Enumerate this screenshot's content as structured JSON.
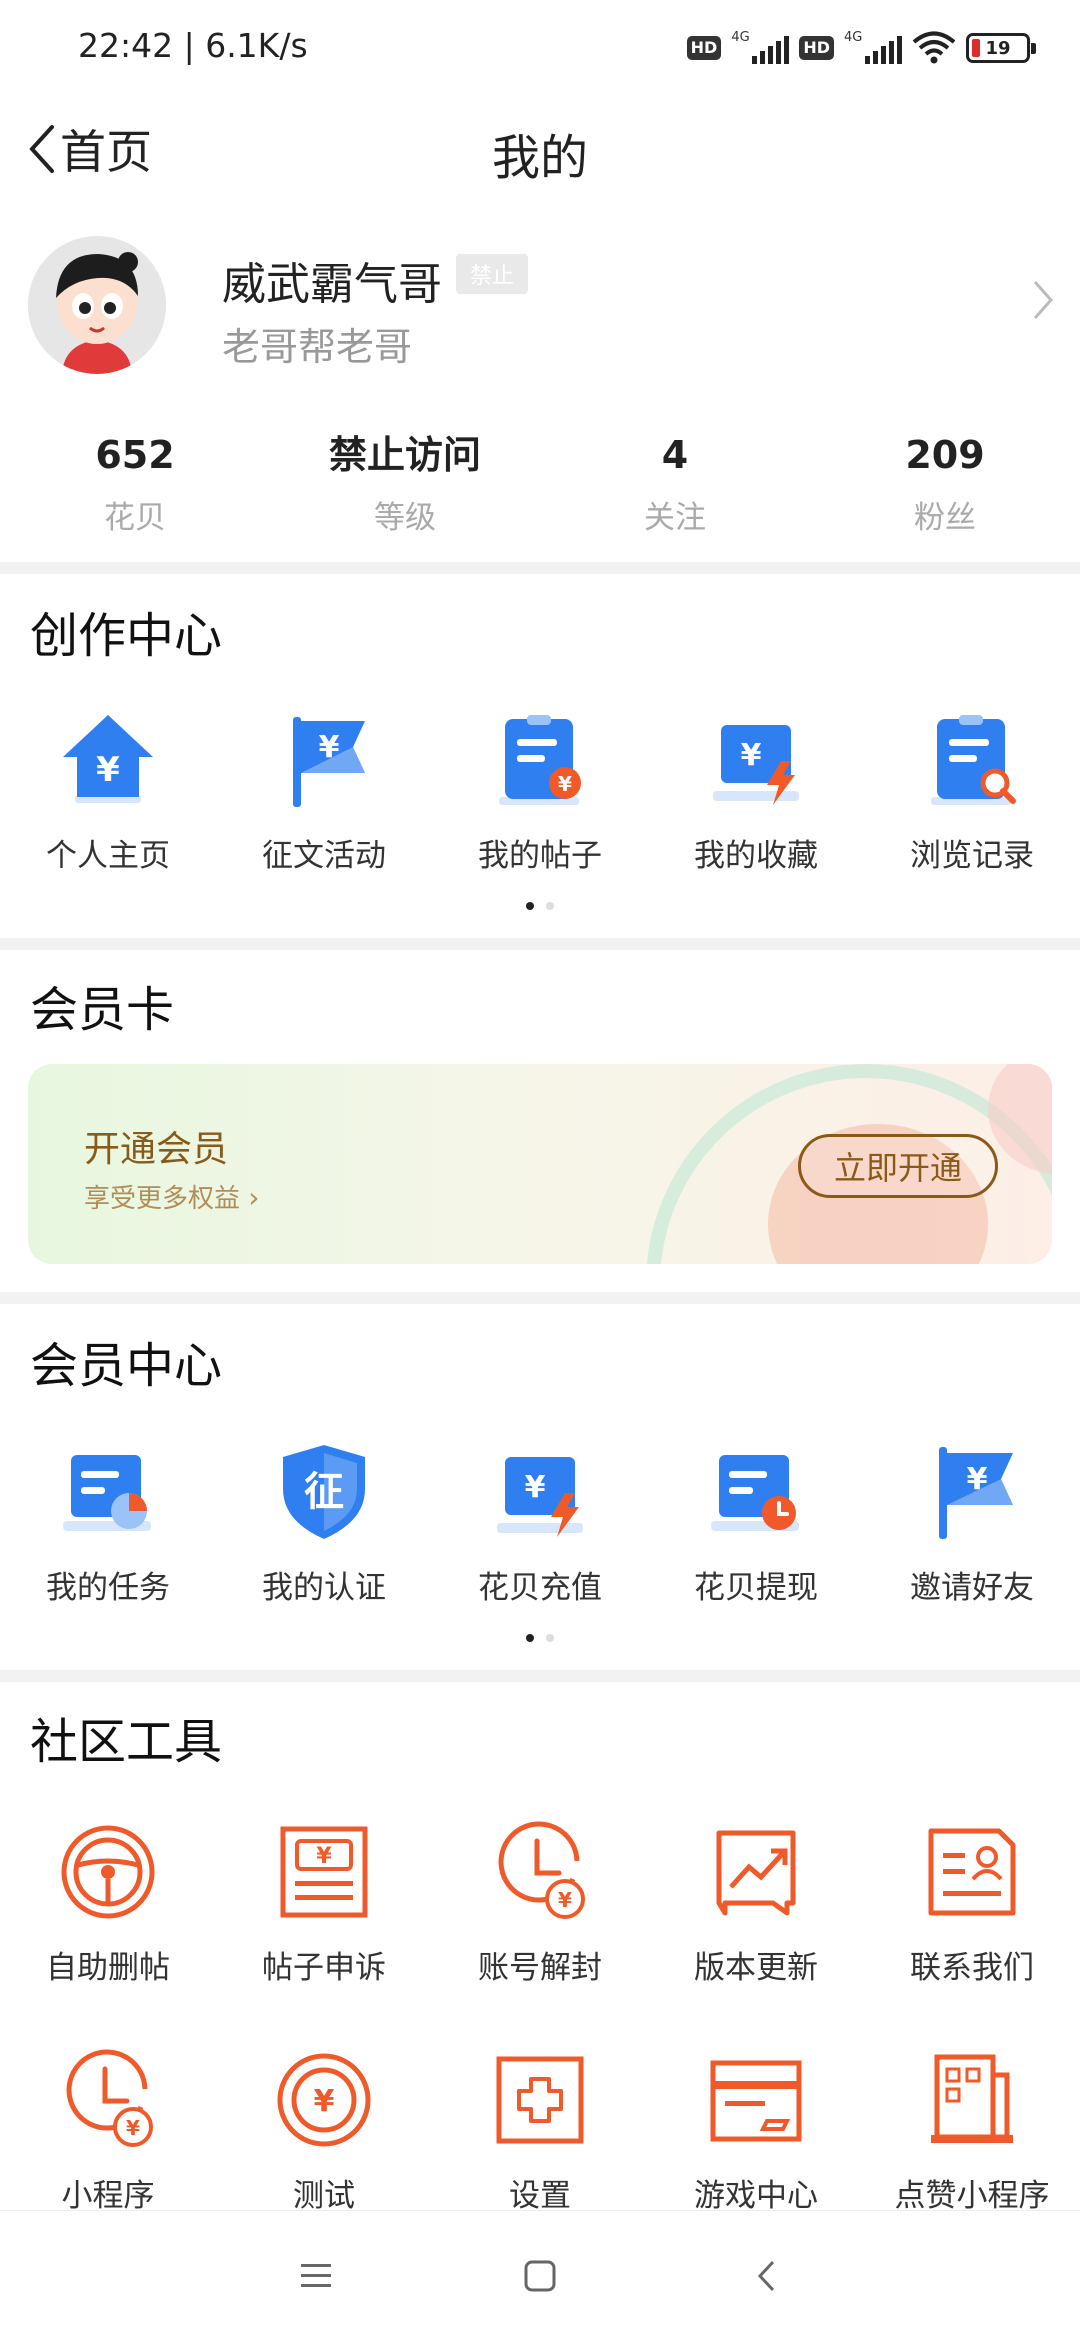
{
  "status_bar": {
    "time": "22:42 | 6.1K/s",
    "hd": "HD",
    "network": "4G",
    "battery": "19"
  },
  "navbar": {
    "back_label": "首页",
    "title": "我的"
  },
  "profile": {
    "name": "威武霸气哥",
    "tag": "禁止",
    "subtitle": "老哥帮老哥"
  },
  "stats": [
    {
      "value": "652",
      "label": "花贝"
    },
    {
      "value": "禁止访问",
      "label": "等级"
    },
    {
      "value": "4",
      "label": "关注"
    },
    {
      "value": "209",
      "label": "粉丝"
    }
  ],
  "creation_center": {
    "title": "创作中心",
    "items": [
      {
        "label": "个人主页",
        "icon": "home-yen-icon"
      },
      {
        "label": "征文活动",
        "icon": "flag-yen-icon"
      },
      {
        "label": "我的帖子",
        "icon": "post-yen-icon"
      },
      {
        "label": "我的收藏",
        "icon": "collect-bolt-icon"
      },
      {
        "label": "浏览记录",
        "icon": "history-search-icon"
      }
    ]
  },
  "vip_card": {
    "title": "会员卡",
    "card_title": "开通会员",
    "card_subtitle": "享受更多权益",
    "button": "立即开通"
  },
  "member_center": {
    "title": "会员中心",
    "items": [
      {
        "label": "我的任务",
        "icon": "task-chart-icon"
      },
      {
        "label": "我的认证",
        "icon": "certify-shield-icon"
      },
      {
        "label": "花贝充值",
        "icon": "recharge-bolt-icon"
      },
      {
        "label": "花贝提现",
        "icon": "withdraw-clock-icon"
      },
      {
        "label": "邀请好友",
        "icon": "invite-flag-icon"
      }
    ]
  },
  "community_tools": {
    "title": "社区工具",
    "row1": [
      {
        "label": "自助删帖",
        "icon": "steering-wheel-icon"
      },
      {
        "label": "帖子申诉",
        "icon": "appeal-ticket-icon"
      },
      {
        "label": "账号解封",
        "icon": "clock-yen-icon"
      },
      {
        "label": "版本更新",
        "icon": "trend-chart-icon"
      },
      {
        "label": "联系我们",
        "icon": "contact-card-icon"
      }
    ],
    "row2": [
      {
        "label": "小程序",
        "icon": "clock-yen-icon"
      },
      {
        "label": "测试",
        "icon": "yen-coin-icon"
      },
      {
        "label": "设置",
        "icon": "plus-square-icon"
      },
      {
        "label": "游戏中心",
        "icon": "card-icon"
      },
      {
        "label": "点赞小程序",
        "icon": "grid-building-icon"
      }
    ]
  },
  "colors": {
    "blue": "#2f7ff0",
    "orange": "#f05a2a",
    "brown": "#8a5a18"
  }
}
